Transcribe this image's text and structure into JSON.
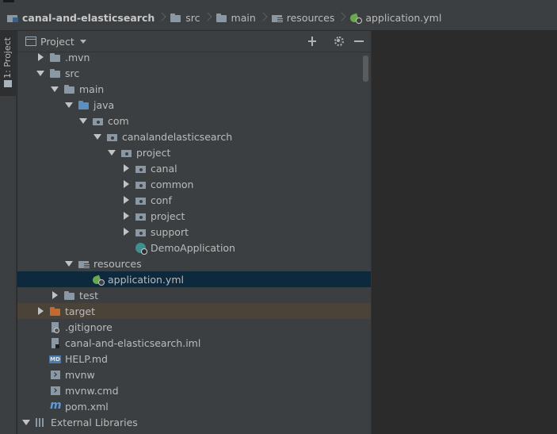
{
  "breadcrumb": [
    {
      "label": "canal-and-elasticsearch",
      "icon": "project-folder-icon",
      "bold": true
    },
    {
      "label": "src",
      "icon": "folder-icon"
    },
    {
      "label": "main",
      "icon": "folder-icon"
    },
    {
      "label": "resources",
      "icon": "resources-folder-icon"
    },
    {
      "label": "application.yml",
      "icon": "spring-config-icon"
    }
  ],
  "side_strip": {
    "tab_label": "1: Project"
  },
  "panel": {
    "title": "Project"
  },
  "tree": [
    {
      "label": ".mvn",
      "level": 1,
      "state": "collapsed",
      "icon": "folder"
    },
    {
      "label": "src",
      "level": 1,
      "state": "expanded",
      "icon": "folder"
    },
    {
      "label": "main",
      "level": 2,
      "state": "expanded",
      "icon": "folder"
    },
    {
      "label": "java",
      "level": 3,
      "state": "expanded",
      "icon": "source-folder"
    },
    {
      "label": "com",
      "level": 4,
      "state": "expanded",
      "icon": "package"
    },
    {
      "label": "canalandelasticsearch",
      "level": 5,
      "state": "expanded",
      "icon": "package"
    },
    {
      "label": "project",
      "level": 6,
      "state": "expanded",
      "icon": "package"
    },
    {
      "label": "canal",
      "level": 7,
      "state": "collapsed",
      "icon": "package"
    },
    {
      "label": "common",
      "level": 7,
      "state": "collapsed",
      "icon": "package"
    },
    {
      "label": "conf",
      "level": 7,
      "state": "collapsed",
      "icon": "package"
    },
    {
      "label": "project",
      "level": 7,
      "state": "collapsed",
      "icon": "package"
    },
    {
      "label": "support",
      "level": 7,
      "state": "collapsed",
      "icon": "package"
    },
    {
      "label": "DemoApplication",
      "level": 7,
      "state": "leaf",
      "icon": "spring-boot-class"
    },
    {
      "label": "resources",
      "level": 3,
      "state": "expanded",
      "icon": "resources-folder"
    },
    {
      "label": "application.yml",
      "level": 4,
      "state": "leaf",
      "icon": "spring-config",
      "selected": true
    },
    {
      "label": "test",
      "level": 2,
      "state": "collapsed",
      "icon": "folder"
    },
    {
      "label": "target",
      "level": 1,
      "state": "collapsed",
      "icon": "excluded-folder",
      "excluded": true
    },
    {
      "label": ".gitignore",
      "level": 1,
      "state": "leaf",
      "icon": "gitignore-file"
    },
    {
      "label": "canal-and-elasticsearch.iml",
      "level": 1,
      "state": "leaf",
      "icon": "iml-file"
    },
    {
      "label": "HELP.md",
      "level": 1,
      "state": "leaf",
      "icon": "markdown-file"
    },
    {
      "label": "mvnw",
      "level": 1,
      "state": "leaf",
      "icon": "shell-script-file"
    },
    {
      "label": "mvnw.cmd",
      "level": 1,
      "state": "leaf",
      "icon": "cmd-file"
    },
    {
      "label": "pom.xml",
      "level": 1,
      "state": "leaf",
      "icon": "maven-file"
    },
    {
      "label": "External Libraries",
      "level": 0,
      "state": "expanded",
      "icon": "libraries"
    }
  ]
}
